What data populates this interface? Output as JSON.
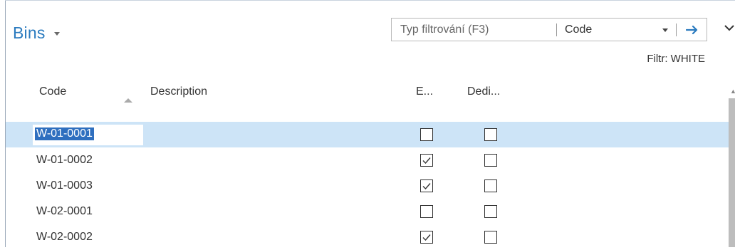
{
  "page": {
    "title": "Bins"
  },
  "filter": {
    "placeholder": "Typ filtrování (F3)",
    "field": "Code",
    "status": "Filtr: WHITE"
  },
  "columns": {
    "code": "Code",
    "description": "Description",
    "empty": "E...",
    "dedicated": "Dedi..."
  },
  "rows": [
    {
      "code": "W-01-0001",
      "description": "",
      "empty": false,
      "dedicated": false,
      "selected": true
    },
    {
      "code": "W-01-0002",
      "description": "",
      "empty": true,
      "dedicated": false,
      "selected": false
    },
    {
      "code": "W-01-0003",
      "description": "",
      "empty": true,
      "dedicated": false,
      "selected": false
    },
    {
      "code": "W-02-0001",
      "description": "",
      "empty": false,
      "dedicated": false,
      "selected": false
    },
    {
      "code": "W-02-0002",
      "description": "",
      "empty": true,
      "dedicated": false,
      "selected": false
    }
  ],
  "icons": {
    "title_caret": "caret-down-icon",
    "field_caret": "caret-down-icon",
    "go": "arrow-right-icon",
    "more": "chevron-down-icon",
    "sort": "sort-ascending-icon",
    "checkbox": "checkbox-icon"
  },
  "colors": {
    "accent": "#2b7bbf",
    "selected_row": "#cde4f7",
    "text_selection": "#2f6fbf"
  }
}
